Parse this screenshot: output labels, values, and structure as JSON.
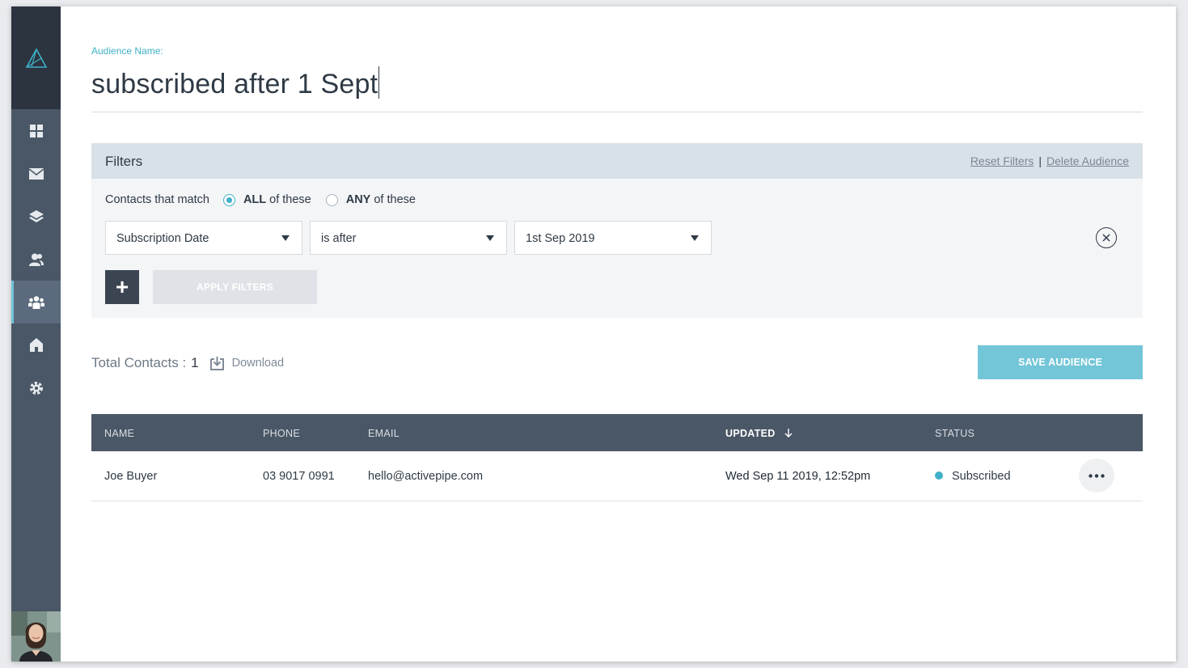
{
  "audience": {
    "label": "Audience Name:",
    "name": "subscribed after 1 Sept"
  },
  "filters": {
    "title": "Filters",
    "reset_label": "Reset Filters",
    "separator": "|",
    "delete_label": "Delete Audience",
    "match_label": "Contacts that match",
    "match_options": [
      {
        "strong": "ALL",
        "rest": "of these",
        "selected": true
      },
      {
        "strong": "ANY",
        "rest": "of these",
        "selected": false
      }
    ],
    "rule": {
      "field": "Subscription Date",
      "operator": "is after",
      "value": "1st Sep 2019"
    },
    "add_label": "+",
    "apply_label": "APPLY FILTERS"
  },
  "summary": {
    "total_label": "Total Contacts :",
    "total_count": "1",
    "download_label": "Download",
    "save_label": "SAVE AUDIENCE"
  },
  "table": {
    "columns": {
      "name": "NAME",
      "phone": "PHONE",
      "email": "EMAIL",
      "updated": "UPDATED",
      "status": "STATUS"
    },
    "rows": [
      {
        "name": "Joe Buyer",
        "phone": "03 9017 0991",
        "email": "hello@activepipe.com",
        "updated": "Wed Sep 11 2019, 12:52pm",
        "status": "Subscribed"
      }
    ]
  },
  "icons": {
    "logo": "triangle-logo-icon",
    "nav": [
      "dashboard-grid-icon",
      "mail-icon",
      "layers-icon",
      "contacts-icon",
      "audience-icon",
      "home-icon",
      "settings-gear-icon"
    ],
    "active_nav": "audience-icon"
  },
  "colors": {
    "accent": "#3fb0c7",
    "sidebar": "#4a5766",
    "sidebar_dark": "#2c3440",
    "table_header": "#4a5766",
    "save_button": "#73c6d8"
  }
}
